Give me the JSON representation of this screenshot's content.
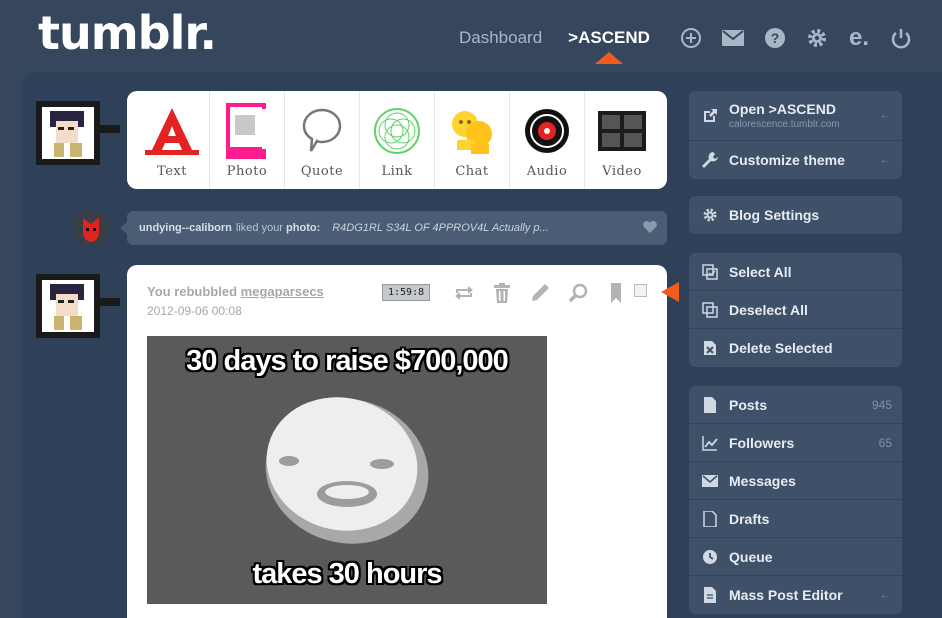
{
  "header": {
    "logo": "tumblr.",
    "nav": [
      {
        "label": "Dashboard",
        "active": false
      },
      {
        "label": ">ASCEND",
        "active": true
      }
    ],
    "icons": [
      "plus-circle-icon",
      "mail-icon",
      "help-icon",
      "gear-icon",
      "e-icon",
      "power-icon"
    ],
    "accent": "#f35b1e"
  },
  "post_types": [
    {
      "label": "Text",
      "icon": "text-icon"
    },
    {
      "label": "Photo",
      "icon": "photo-icon"
    },
    {
      "label": "Quote",
      "icon": "quote-icon"
    },
    {
      "label": "Link",
      "icon": "link-icon"
    },
    {
      "label": "Chat",
      "icon": "chat-icon"
    },
    {
      "label": "Audio",
      "icon": "audio-icon"
    },
    {
      "label": "Video",
      "icon": "video-icon"
    }
  ],
  "notification": {
    "user": "undying--caliborn",
    "action": "liked your",
    "object": "photo:",
    "quote": "R4DG1RL S34L OF 4PPROV4L Actually p..."
  },
  "post": {
    "header_prefix": "You rebubbled",
    "source_user": "megaparsecs",
    "date": "2012-09-06 00:08",
    "time_badge": "1:59:8",
    "image": {
      "top_text": "30 days to raise $700,000",
      "bottom_text": "takes 30 hours"
    }
  },
  "sidebar": {
    "blog": [
      {
        "label": "Open >ASCEND",
        "sub": "calorescence.tumblr.com",
        "icon": "external-link-icon"
      },
      {
        "label": "Customize theme",
        "icon": "wrench-icon"
      }
    ],
    "settings": [
      {
        "label": "Blog Settings",
        "icon": "gear-icon"
      }
    ],
    "selection": [
      {
        "label": "Select All",
        "icon": "select-all-icon"
      },
      {
        "label": "Deselect All",
        "icon": "deselect-all-icon"
      },
      {
        "label": "Delete Selected",
        "icon": "delete-selected-icon"
      }
    ],
    "stats": [
      {
        "label": "Posts",
        "count": "945",
        "icon": "document-icon"
      },
      {
        "label": "Followers",
        "count": "65",
        "icon": "chart-icon"
      },
      {
        "label": "Messages",
        "icon": "mail-icon"
      },
      {
        "label": "Drafts",
        "icon": "document-icon"
      },
      {
        "label": "Queue",
        "icon": "clock-icon"
      },
      {
        "label": "Mass Post Editor",
        "icon": "document-icon"
      }
    ]
  }
}
